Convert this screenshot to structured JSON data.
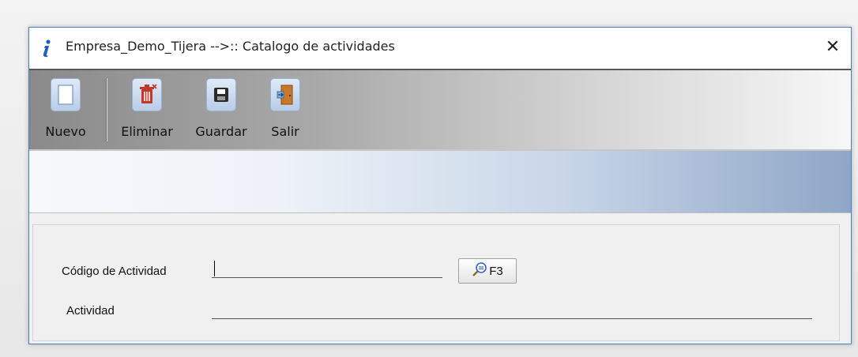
{
  "window": {
    "title": "Empresa_Demo_Tijera -->:: Catalogo de actividades",
    "close_glyph": "✕"
  },
  "toolbar": {
    "items": [
      {
        "label": "Nuevo",
        "icon": "new-document-icon"
      },
      {
        "label": "Eliminar",
        "icon": "trash-icon"
      },
      {
        "label": "Guardar",
        "icon": "save-icon"
      },
      {
        "label": "Salir",
        "icon": "exit-door-icon"
      }
    ]
  },
  "form": {
    "codigo_label": "Código de Actividad",
    "codigo_value": "",
    "search_button_label": "F3",
    "actividad_label": "Actividad",
    "actividad_value": ""
  },
  "colors": {
    "window_border": "#4a7fc1",
    "icon_accent": "#c0392b"
  }
}
